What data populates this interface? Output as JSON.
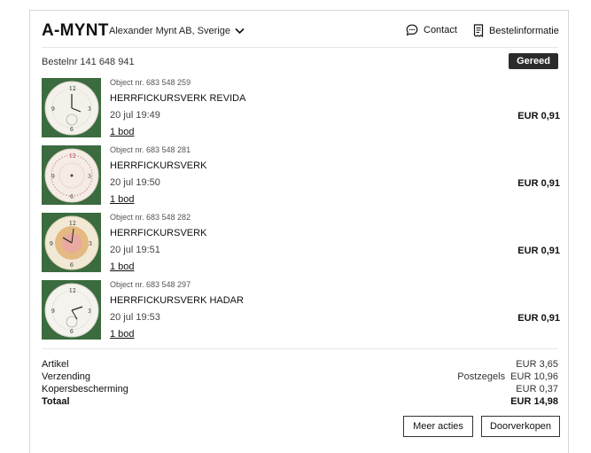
{
  "header": {
    "logo": "A-MYNT",
    "seller": "Alexander Mynt AB, Sverige",
    "contact_label": "Contact",
    "order_info_label": "Bestelinformatie"
  },
  "order": {
    "number_label": "Bestelnr 141 648 941",
    "status": "Gereed"
  },
  "items": [
    {
      "object": "Object nr. 683 548 259",
      "title": "HERRFICKURSVERK REVIDA",
      "time": "20 jul 19:49",
      "bids": "1 bod",
      "price": "EUR 0,91"
    },
    {
      "object": "Object nr. 683 548 281",
      "title": "HERRFICKURSVERK",
      "time": "20 jul 19:50",
      "bids": "1 bod",
      "price": "EUR 0,91"
    },
    {
      "object": "Object nr. 683 548 282",
      "title": "HERRFICKURSVERK",
      "time": "20 jul 19:51",
      "bids": "1 bod",
      "price": "EUR 0,91"
    },
    {
      "object": "Object nr. 683 548 297",
      "title": "HERRFICKURSVERK HADAR",
      "time": "20 jul 19:53",
      "bids": "1 bod",
      "price": "EUR 0,91"
    }
  ],
  "summary": {
    "article_label": "Artikel",
    "article_value": "EUR 3,65",
    "shipping_label": "Verzending",
    "shipping_value": "Postzegels  EUR 10,96",
    "protection_label": "Kopersbescherming",
    "protection_value": "EUR 0,37",
    "total_label": "Totaal",
    "total_value": "EUR 14,98"
  },
  "actions": {
    "more_label": "Meer acties",
    "resell_label": "Doorverkopen"
  },
  "colors": {
    "status_bg": "#2b2b2b",
    "thumb_bg": "#3b6b3e"
  },
  "icons": [
    "chevron-down-icon",
    "chat-icon",
    "receipt-icon"
  ]
}
